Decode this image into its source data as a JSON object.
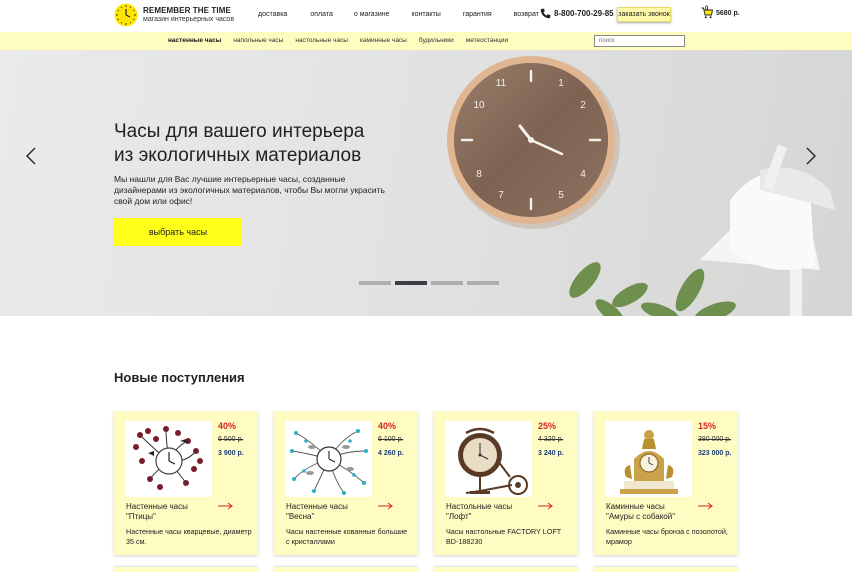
{
  "brand": {
    "title": "REMEMBER THE TIME",
    "subtitle": "магазин интерьерных часов",
    "accent_color": "#ffff1a",
    "light_yellow": "#fffcc0"
  },
  "topnav": [
    "доставка",
    "оплата",
    "о магазине",
    "контакты",
    "гарантия",
    "возврат"
  ],
  "contact": {
    "phone": "8-800-700-29-85",
    "callback_label": "заказать звонок",
    "phone_icon": "phone-icon"
  },
  "cart": {
    "count": "0",
    "total": "5680 р.",
    "icon": "cart-icon"
  },
  "categories": [
    {
      "label": "настенные часы",
      "active": true
    },
    {
      "label": "напольные часы",
      "active": false
    },
    {
      "label": "настольные часы",
      "active": false
    },
    {
      "label": "каминные часы",
      "active": false
    },
    {
      "label": "будильники",
      "active": false
    },
    {
      "label": "метеостанции",
      "active": false
    }
  ],
  "search": {
    "placeholder": "поиск",
    "value": ""
  },
  "hero": {
    "title_line1": "Часы для вашего интерьера",
    "title_line2": "из экологичных материалов",
    "text": "Мы нашли для Вас лучшие интерьерные часы, созданные дизайнерами из экологичных материалов, чтобы Вы могли украсить свой дом или офис!",
    "button_label": "выбрать часы",
    "slides_count": 4,
    "active_slide": 2
  },
  "section_title": "Новые поступления",
  "products": [
    {
      "discount": "40%",
      "old_price": "6 500 р.",
      "new_price": "3 900 р.",
      "name_line1": "Настенные часы",
      "name_line2": "\"Птицы\"",
      "desc": "Настенные часы кварцевые, диаметр 35 см."
    },
    {
      "discount": "40%",
      "old_price": "6 100 р.",
      "new_price": "4 260 р.",
      "name_line1": "Настенные часы",
      "name_line2": "\"Весна\"",
      "desc": "Часы настенные кованные большие с кристаллами"
    },
    {
      "discount": "25%",
      "old_price": "4 320 р.",
      "new_price": "3 240 р.",
      "name_line1": "Настольные часы",
      "name_line2": "\"Лофт\"",
      "desc": "Часы настольные FACTORY LOFT BD-188230"
    },
    {
      "discount": "15%",
      "old_price": "380 000 р.",
      "new_price": "323 000 р.",
      "name_line1": "Каминные часы",
      "name_line2": "\"Амуры с собакой\"",
      "desc": "Каминные часы бронза с позолотой, мрамор"
    }
  ]
}
